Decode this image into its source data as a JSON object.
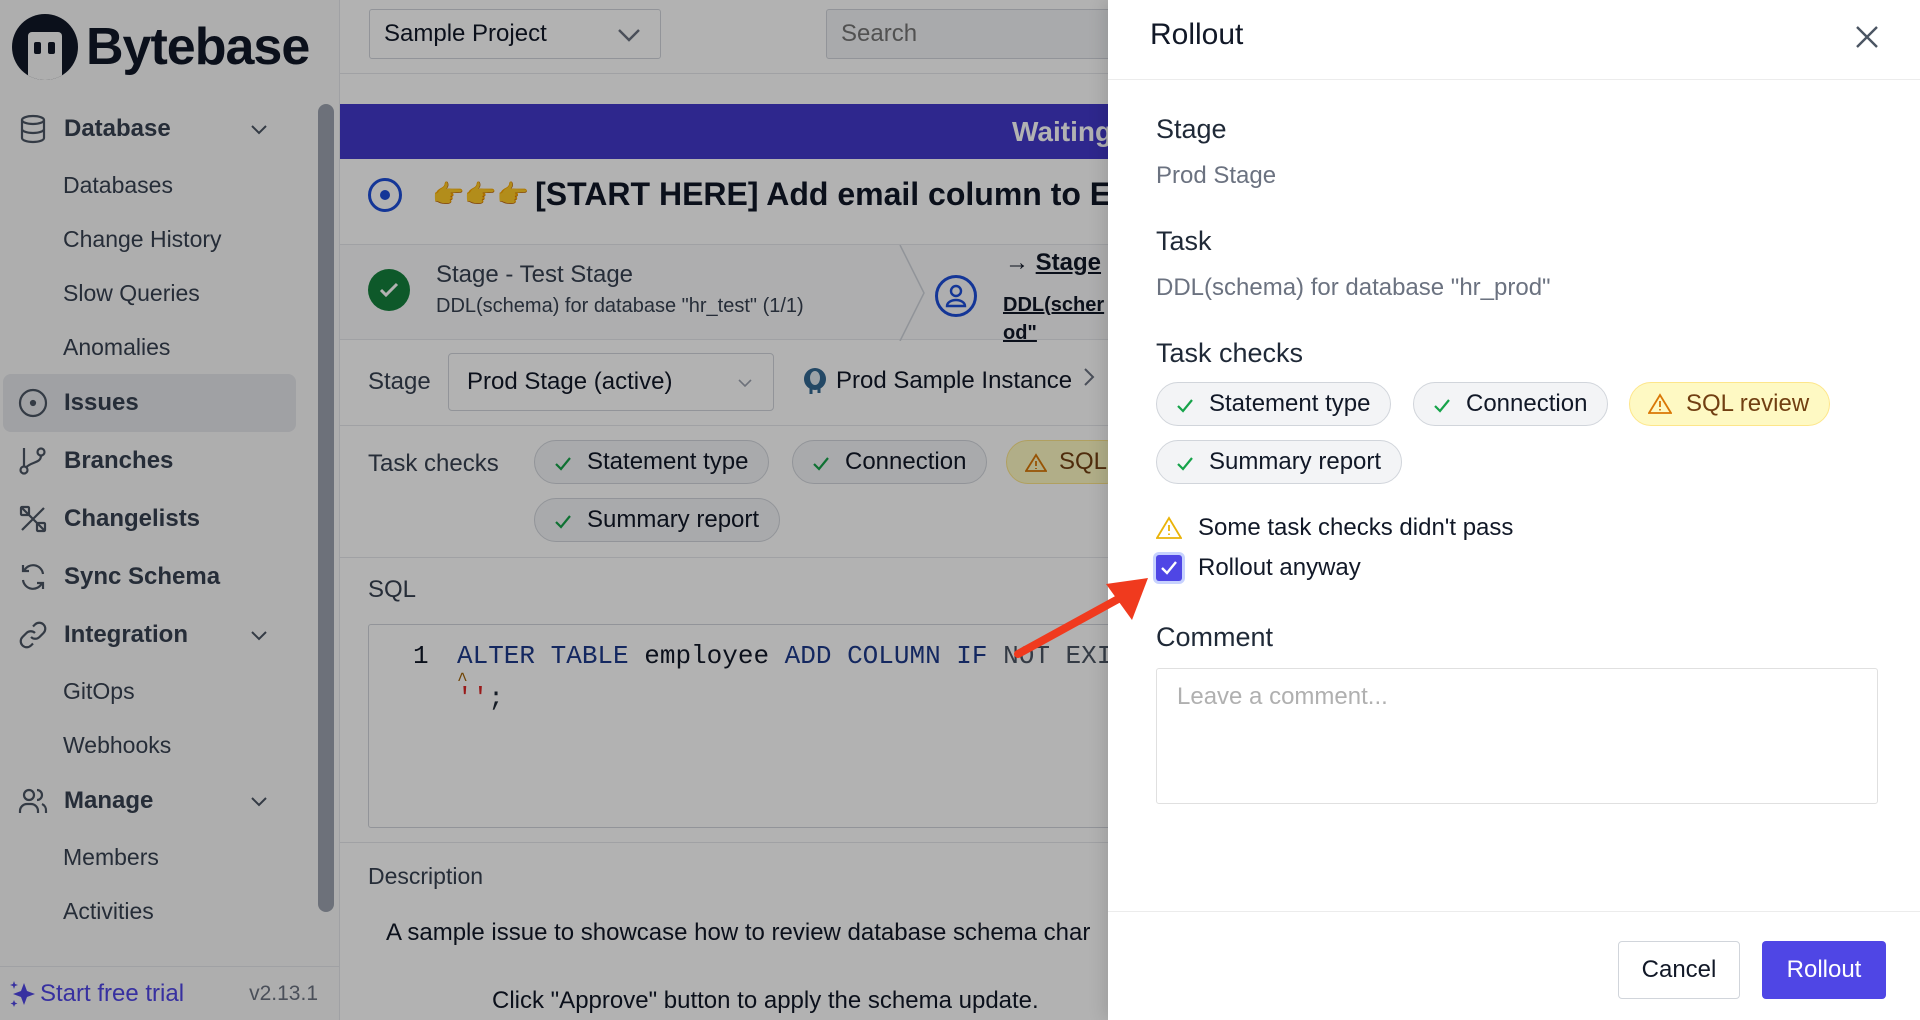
{
  "app": {
    "brand": "Bytebase",
    "version": "v2.13.1",
    "trial_label": "Start free trial"
  },
  "sidebar": {
    "groups": [
      {
        "label": "Database",
        "icon": "database-icon",
        "expanded": true,
        "items": [
          "Databases",
          "Change History",
          "Slow Queries",
          "Anomalies"
        ]
      },
      {
        "label": "Issues",
        "icon": "issue-circle-icon",
        "active": true
      },
      {
        "label": "Branches",
        "icon": "branch-icon"
      },
      {
        "label": "Changelists",
        "icon": "changelist-icon"
      },
      {
        "label": "Sync Schema",
        "icon": "sync-icon"
      },
      {
        "label": "Integration",
        "icon": "link-icon",
        "expanded": true,
        "items": [
          "GitOps",
          "Webhooks"
        ]
      },
      {
        "label": "Manage",
        "icon": "users-icon",
        "expanded": true,
        "items": [
          "Members",
          "Activities"
        ]
      }
    ]
  },
  "topbar": {
    "project": "Sample Project",
    "search_placeholder": "Search"
  },
  "issue": {
    "banner": "Waiting",
    "title_emoji": "👉👉👉",
    "title": "[START HERE] Add email column to Emp",
    "stages": [
      {
        "title": "Stage - Test Stage",
        "subtitle": "DDL(schema) for database \"hr_test\" (1/1)",
        "status": "done"
      },
      {
        "title": "Stage",
        "arrow": "→",
        "subtitle": "DDL(scher",
        "subtitle2": "od\"",
        "status": "pending-approval"
      }
    ],
    "stage_label": "Stage",
    "stage_select": "Prod Stage (active)",
    "instance": "Prod Sample Instance",
    "task_checks_label": "Task checks",
    "task_checks": [
      {
        "label": "Statement type",
        "status": "success"
      },
      {
        "label": "Connection",
        "status": "success"
      },
      {
        "label": "SQL",
        "status": "warning"
      },
      {
        "label": "Summary report",
        "status": "success"
      }
    ],
    "sql_label": "SQL",
    "sql": {
      "line_number": "1",
      "tokens": [
        {
          "t": "ALTER TABLE",
          "k": "kw"
        },
        {
          "t": " employee ",
          "k": ""
        },
        {
          "t": "ADD COLUMN IF",
          "k": "kw"
        },
        {
          "t": " NOT EXISTS",
          "k": "kw2"
        }
      ],
      "line2_quotes": "''",
      "line2_end": ";",
      "caret": "^"
    },
    "description_label": "Description",
    "description_line1": "A sample issue to showcase how to review database schema char",
    "description_line2": "Click \"Approve\" button to apply the schema update."
  },
  "drawer": {
    "title": "Rollout",
    "stage_heading": "Stage",
    "stage_value": "Prod Stage",
    "task_heading": "Task",
    "task_value": "DDL(schema) for database \"hr_prod\"",
    "checks_heading": "Task checks",
    "checks": [
      {
        "label": "Statement type",
        "status": "success"
      },
      {
        "label": "Connection",
        "status": "success"
      },
      {
        "label": "SQL review",
        "status": "warning"
      },
      {
        "label": "Summary report",
        "status": "success"
      }
    ],
    "warning_text": "Some task checks didn't pass",
    "rollout_anyway_label": "Rollout anyway",
    "rollout_anyway_checked": true,
    "comment_heading": "Comment",
    "comment_placeholder": "Leave a comment...",
    "comment_value": "",
    "cancel_label": "Cancel",
    "rollout_label": "Rollout"
  },
  "colors": {
    "accent": "#4f46e5",
    "banner": "#4338ca",
    "success": "#16a34a",
    "warning": "#d97706",
    "annotation_arrow": "#f03a1e"
  }
}
